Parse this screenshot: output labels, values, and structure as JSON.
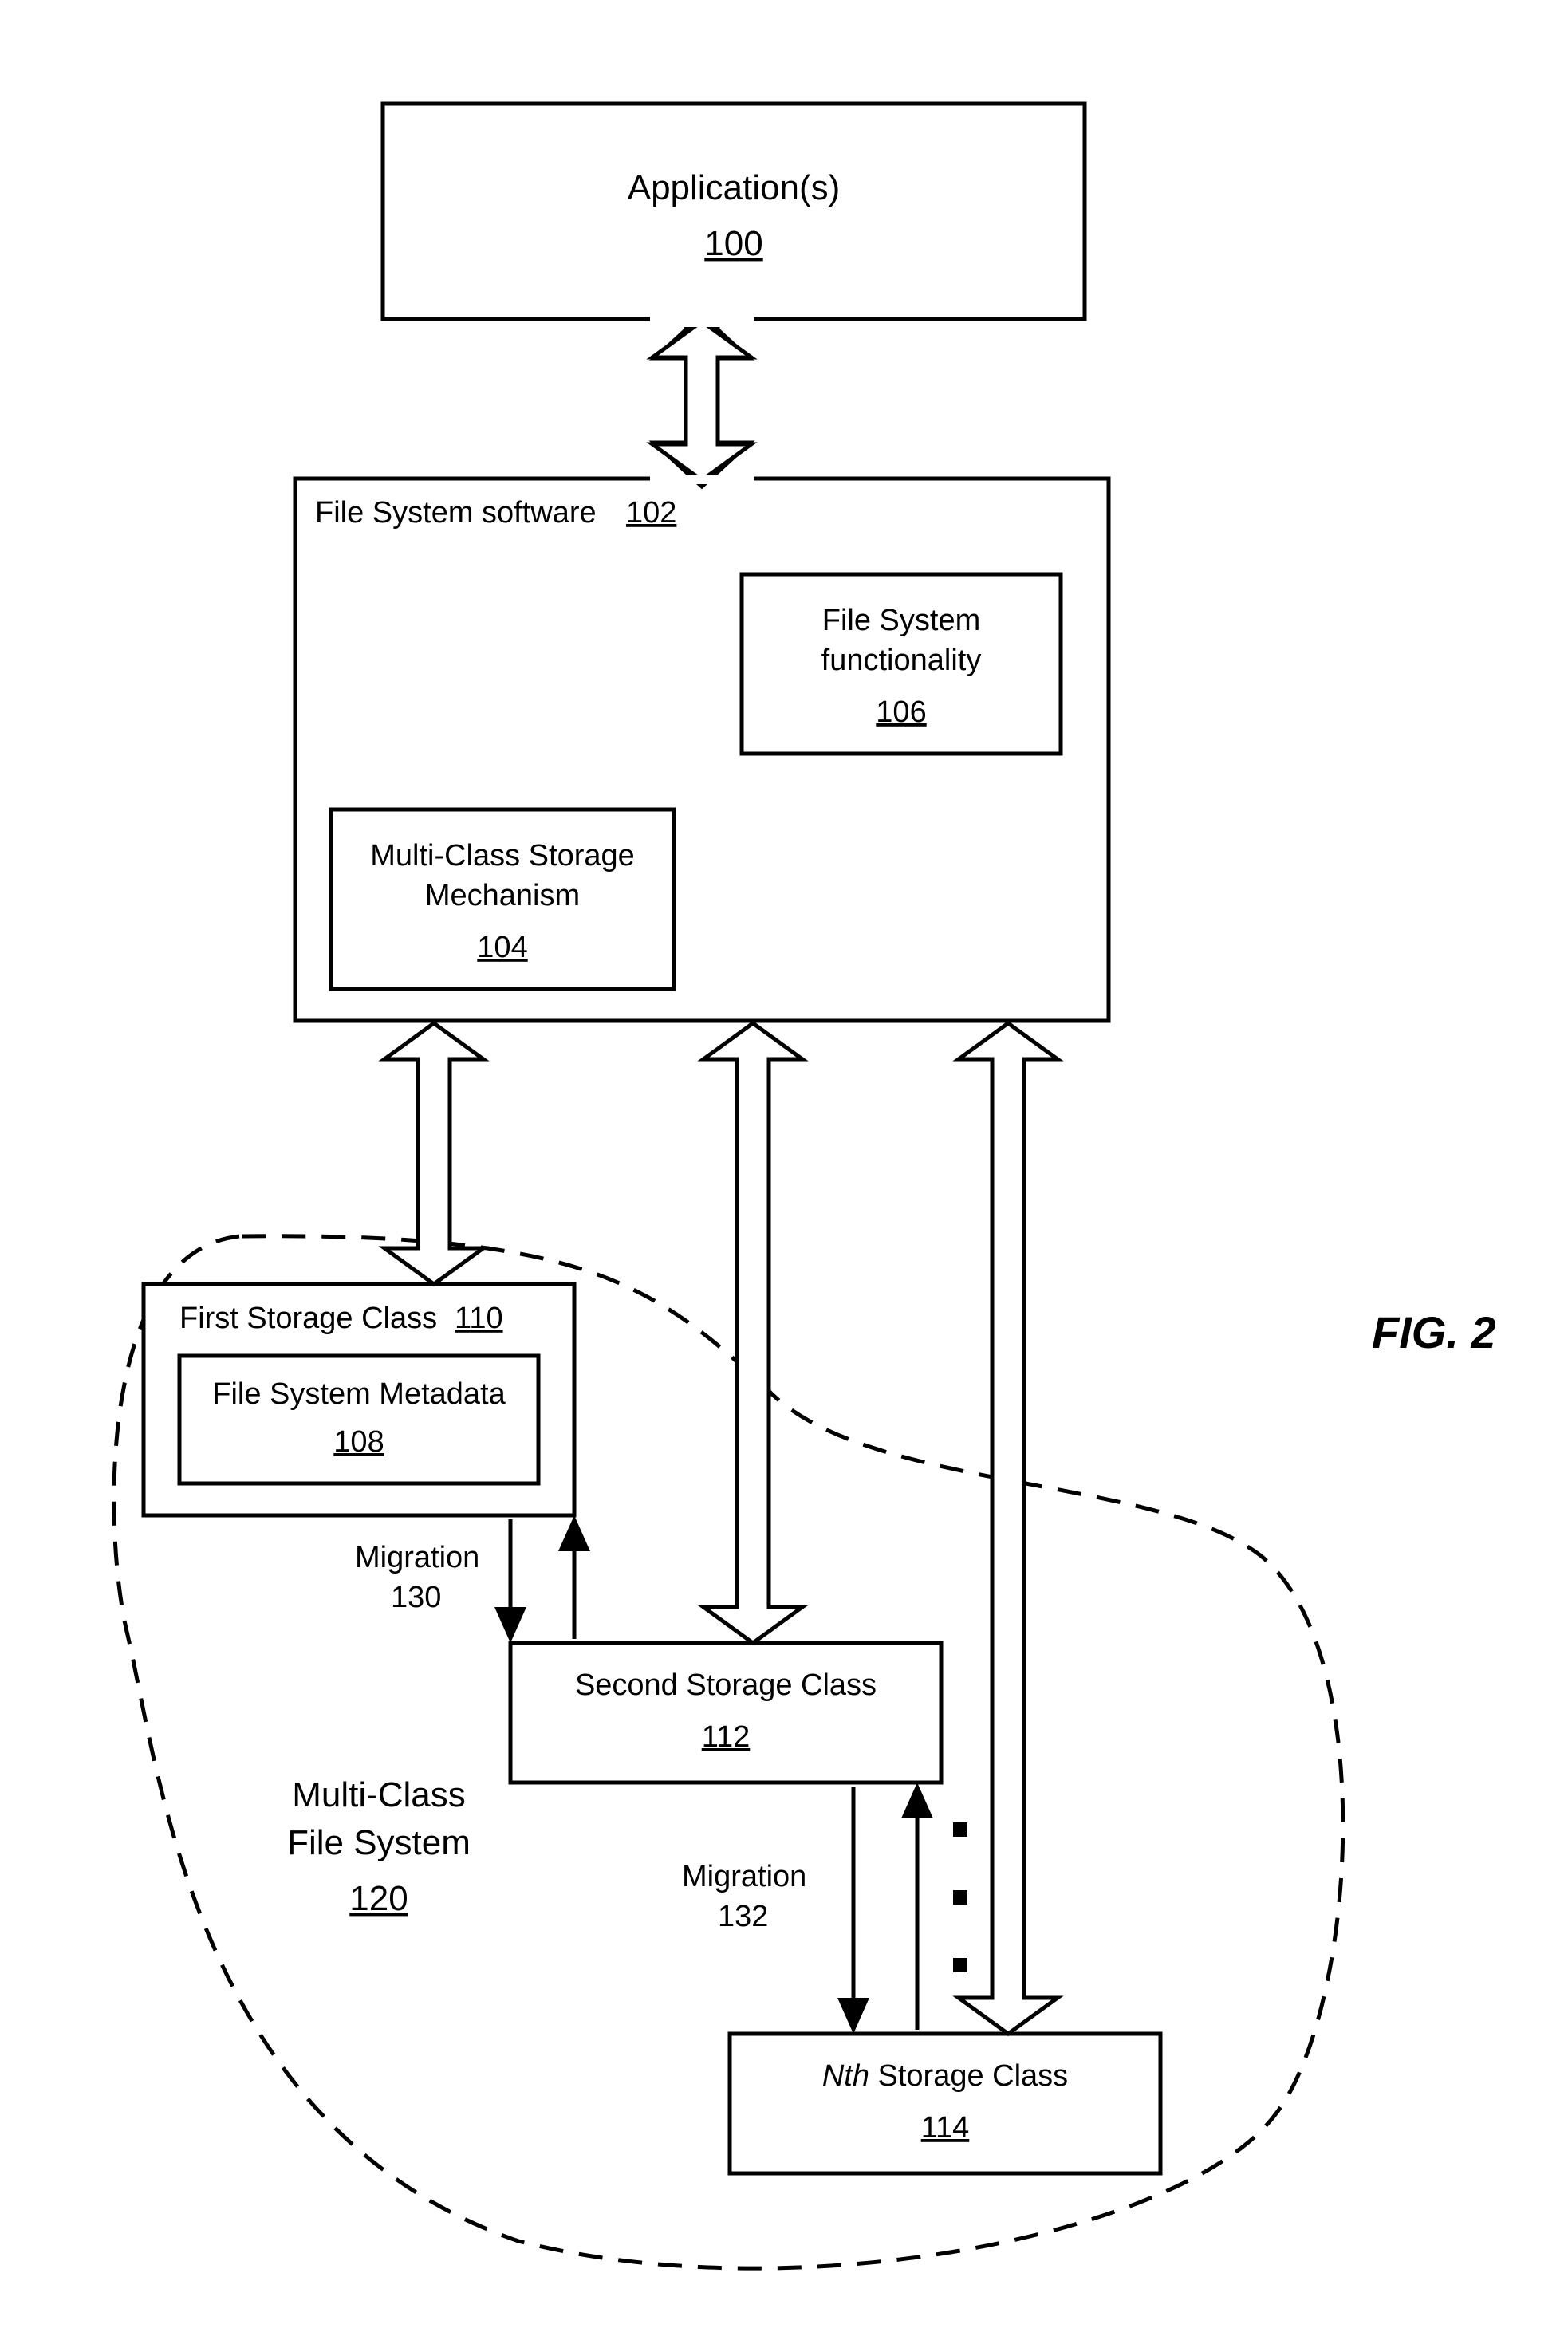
{
  "figure_label": "FIG. 2",
  "applications": {
    "title": "Application(s)",
    "ref": "100"
  },
  "file_system_software": {
    "title": "File System software",
    "ref": "102",
    "functionality": {
      "title_l1": "File System",
      "title_l2": "functionality",
      "ref": "106"
    },
    "mcsm": {
      "title_l1": "Multi-Class Storage",
      "title_l2": "Mechanism",
      "ref": "104"
    }
  },
  "first_storage_class": {
    "title": "First Storage Class",
    "ref": "110",
    "metadata": {
      "title": "File System Metadata",
      "ref": "108"
    }
  },
  "second_storage_class": {
    "title": "Second Storage Class",
    "ref": "112"
  },
  "nth_storage_class": {
    "title_prefix": "Nth",
    "title_suffix": " Storage Class",
    "ref": "114"
  },
  "multi_class_fs": {
    "title_l1": "Multi-Class",
    "title_l2": "File System",
    "ref": "120"
  },
  "migration130": {
    "title": "Migration",
    "ref": "130"
  },
  "migration132": {
    "title": "Migration",
    "ref": "132"
  }
}
